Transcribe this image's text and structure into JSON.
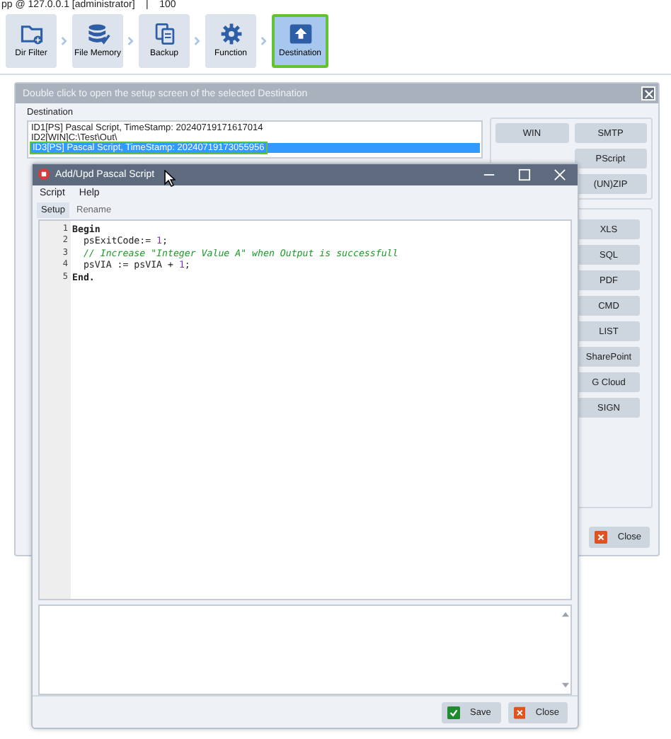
{
  "app_title": "pp @ 127.0.0.1 [administrator]    |    100",
  "toolbar": [
    {
      "label": "Dir Filter",
      "selected": false
    },
    {
      "label": "File Memory",
      "selected": false
    },
    {
      "label": "Backup",
      "selected": false
    },
    {
      "label": "Function",
      "selected": false
    },
    {
      "label": "Destination",
      "selected": true
    }
  ],
  "destination_window": {
    "title": "Double click to open the setup screen of the selected Destination",
    "group_label": "Destination",
    "list": [
      {
        "text": "ID1[PS] Pascal Script, TimeStamp: 20240719171617014",
        "selected": false
      },
      {
        "text": "ID2[WIN]C:\\Test\\Out\\",
        "selected": false
      },
      {
        "text": "ID3[PS] Pascal Script, TimeStamp: 20240719173055956",
        "selected": true
      }
    ],
    "type_buttons": [
      "WIN",
      "SMTP",
      "PScript",
      "(UN)ZIP"
    ],
    "export_buttons": [
      "XLS",
      "SQL",
      "PDF",
      "CMD",
      "LIST",
      "SharePoint",
      "G Cloud",
      "SIGN"
    ],
    "close_button": "Close"
  },
  "script_dialog": {
    "title": "Add/Upd Pascal Script",
    "menu": [
      "Script",
      "Help"
    ],
    "tabs": [
      {
        "label": "Setup",
        "selected": true
      },
      {
        "label": "Rename",
        "selected": false
      }
    ],
    "code": [
      {
        "number": "1",
        "tokens": [
          {
            "kind": "keyword",
            "text": "Begin"
          }
        ]
      },
      {
        "number": "2",
        "tokens": [
          {
            "kind": "plain",
            "text": "  psExitCode:= "
          },
          {
            "kind": "number",
            "text": "1"
          },
          {
            "kind": "plain",
            "text": ";"
          }
        ]
      },
      {
        "number": "3",
        "tokens": [
          {
            "kind": "comment",
            "text": "  // Increase \"Integer Value A\" when Output is successfull"
          }
        ]
      },
      {
        "number": "4",
        "tokens": [
          {
            "kind": "plain",
            "text": "  psVIA := psVIA + "
          },
          {
            "kind": "number",
            "text": "1"
          },
          {
            "kind": "plain",
            "text": ";"
          }
        ]
      },
      {
        "number": "5",
        "tokens": [
          {
            "kind": "keyword",
            "text": "End."
          }
        ]
      }
    ],
    "buttons": [
      {
        "kind": "save",
        "label": "Save"
      },
      {
        "kind": "close",
        "label": "Close"
      }
    ]
  }
}
